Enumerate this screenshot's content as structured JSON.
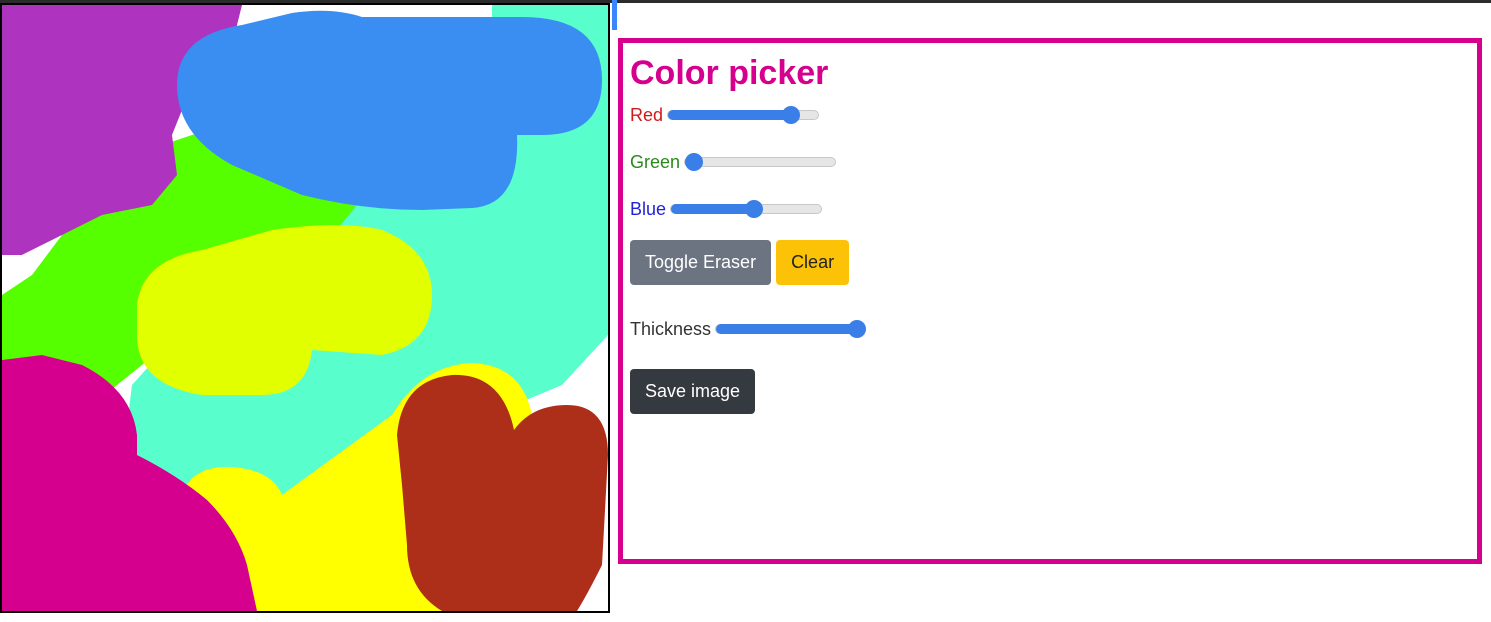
{
  "panel": {
    "title": "Color picker",
    "accent_color": "#d6008f"
  },
  "controls": {
    "red": {
      "label": "Red",
      "value_fraction": 0.85
    },
    "green": {
      "label": "Green",
      "value_fraction": 0.0
    },
    "blue": {
      "label": "Blue",
      "value_fraction": 0.55
    },
    "thickness": {
      "label": "Thickness",
      "value_fraction": 1.0
    }
  },
  "buttons": {
    "toggle_eraser": "Toggle Eraser",
    "clear": "Clear",
    "save_image": "Save image"
  },
  "canvas": {
    "stroke_colors": [
      "#ae33be",
      "#3a8ef2",
      "#58ffcc",
      "#55ff00",
      "#e2ff00",
      "#d6008f",
      "#ffff00",
      "#ad2f19"
    ]
  }
}
